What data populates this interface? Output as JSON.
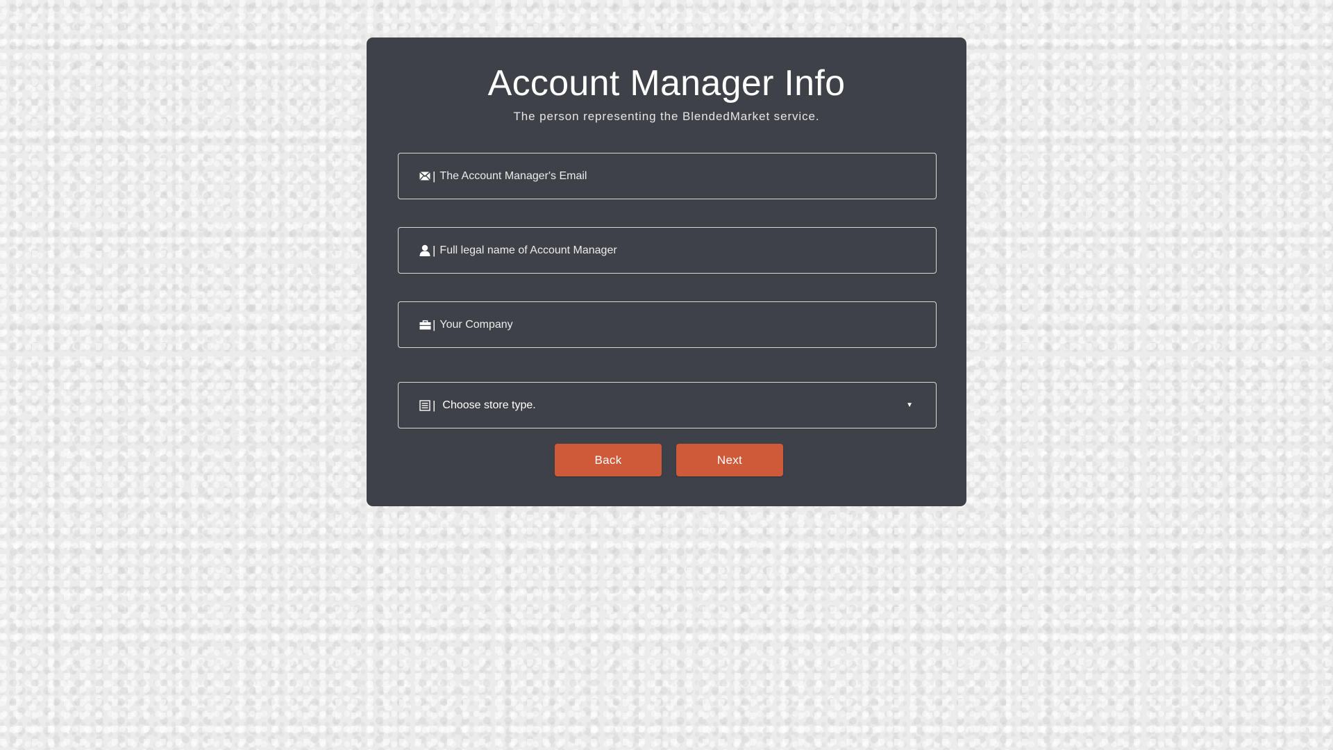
{
  "header": {
    "title": "Account Manager Info",
    "subtitle": "The person representing the BlendedMarket service."
  },
  "form": {
    "email": {
      "icon": "envelope-icon",
      "separator": "|",
      "placeholder": "The Account Manager's Email",
      "value": ""
    },
    "full_name": {
      "icon": "user-icon",
      "separator": "|",
      "placeholder": "Full legal name of Account Manager",
      "value": ""
    },
    "company": {
      "icon": "briefcase-icon",
      "separator": "|",
      "placeholder": "Your Company",
      "value": ""
    },
    "store_type": {
      "icon": "list-icon",
      "separator": "|",
      "selected": "Choose store type.",
      "caret": "▼"
    }
  },
  "buttons": {
    "back_label": "Back",
    "next_label": "Next"
  },
  "colors": {
    "card_background": "#3f4149",
    "button_background": "#cf5a3a",
    "page_background": "#ececec",
    "text": "#ffffff"
  }
}
